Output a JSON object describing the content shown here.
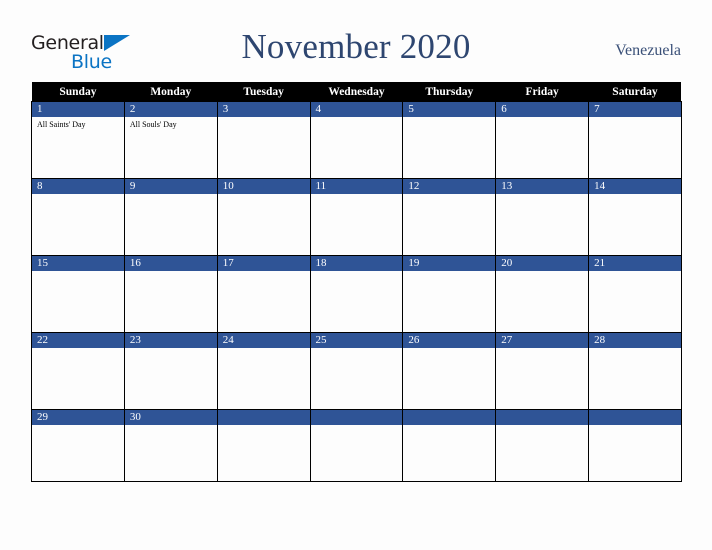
{
  "brand": {
    "name_part1": "General",
    "name_part2": "Blue",
    "triangle_icon": "triangle-icon",
    "color_dark": "#231f20",
    "color_blue": "#0b74c4"
  },
  "header": {
    "title": "November 2020",
    "country": "Venezuela",
    "title_color": "#2e4670"
  },
  "calendar": {
    "accent_color": "#2f5496",
    "header_bg": "#000000",
    "weekday_headers": [
      "Sunday",
      "Monday",
      "Tuesday",
      "Wednesday",
      "Thursday",
      "Friday",
      "Saturday"
    ],
    "weeks": [
      [
        {
          "date": "1",
          "events": [
            "All Saints' Day"
          ]
        },
        {
          "date": "2",
          "events": [
            "All Souls' Day"
          ]
        },
        {
          "date": "3",
          "events": []
        },
        {
          "date": "4",
          "events": []
        },
        {
          "date": "5",
          "events": []
        },
        {
          "date": "6",
          "events": []
        },
        {
          "date": "7",
          "events": []
        }
      ],
      [
        {
          "date": "8",
          "events": []
        },
        {
          "date": "9",
          "events": []
        },
        {
          "date": "10",
          "events": []
        },
        {
          "date": "11",
          "events": []
        },
        {
          "date": "12",
          "events": []
        },
        {
          "date": "13",
          "events": []
        },
        {
          "date": "14",
          "events": []
        }
      ],
      [
        {
          "date": "15",
          "events": []
        },
        {
          "date": "16",
          "events": []
        },
        {
          "date": "17",
          "events": []
        },
        {
          "date": "18",
          "events": []
        },
        {
          "date": "19",
          "events": []
        },
        {
          "date": "20",
          "events": []
        },
        {
          "date": "21",
          "events": []
        }
      ],
      [
        {
          "date": "22",
          "events": []
        },
        {
          "date": "23",
          "events": []
        },
        {
          "date": "24",
          "events": []
        },
        {
          "date": "25",
          "events": []
        },
        {
          "date": "26",
          "events": []
        },
        {
          "date": "27",
          "events": []
        },
        {
          "date": "28",
          "events": []
        }
      ],
      [
        {
          "date": "29",
          "events": []
        },
        {
          "date": "30",
          "events": []
        },
        {
          "date": "",
          "events": []
        },
        {
          "date": "",
          "events": []
        },
        {
          "date": "",
          "events": []
        },
        {
          "date": "",
          "events": []
        },
        {
          "date": "",
          "events": []
        }
      ]
    ]
  }
}
